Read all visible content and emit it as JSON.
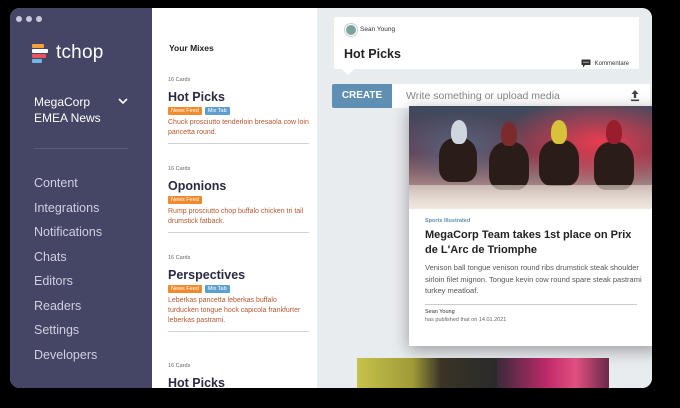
{
  "brand": {
    "name": "tchop"
  },
  "sidebar": {
    "org_line1": "MegaCorp",
    "org_line2": "EMEA News",
    "items": [
      {
        "label": "Content"
      },
      {
        "label": "Integrations"
      },
      {
        "label": "Notifications"
      },
      {
        "label": "Chats"
      },
      {
        "label": "Editors"
      },
      {
        "label": "Readers"
      },
      {
        "label": "Settings"
      },
      {
        "label": "Developers"
      }
    ]
  },
  "mixes": {
    "title": "Your Mixes",
    "items": [
      {
        "count": "16 Cards",
        "title": "Hot Picks",
        "tags": [
          "News Feed",
          "Mix Tab"
        ],
        "desc": "Chuck prosciutto tenderloin bresaola cow loin pancetta round."
      },
      {
        "count": "16 Cards",
        "title": "Oponions",
        "tags": [
          "News Feed"
        ],
        "desc": "Rump prosciutto chop buffalo chicken tri tail drumstick fatback."
      },
      {
        "count": "16 Cards",
        "title": "Perspectives",
        "tags": [
          "News Feed",
          "Mix Tab"
        ],
        "desc": "Leberkas pancetta leberkas buffalo turducken tongue hock capicola frankfurter leberkas pastrami."
      },
      {
        "count": "16 Cards",
        "title": "Hot Picks"
      }
    ]
  },
  "main": {
    "mix_card": {
      "author": "Sean Young",
      "title": "Hot Picks",
      "comments_label": "Kommentare"
    },
    "create": {
      "button_label": "CREATE",
      "placeholder": "Write something or upload media"
    },
    "post": {
      "source": "Sports Illustrated",
      "title": "MegaCorp Team takes 1st place on Prix de L'Arc de Triomphe",
      "body": "Venison ball tongue venison round ribs drumstick steak shoulder sirloin filet mignon. Tongue kevin cow round spare steak pastrami turkey meatloaf.",
      "author": "Sean Young",
      "date_line": "has published that on 14.01.2021"
    }
  },
  "colors": {
    "sidebar_bg": "#454566",
    "accent_blue": "#5f8fb2",
    "tag_news_feed": "#f08a2c",
    "tag_mix_tab": "#5f9fd0",
    "mix_desc": "#b7572f"
  },
  "icons": [
    "window-controls",
    "tchop-logo-icon",
    "chevron-down-icon",
    "comment-icon",
    "upload-icon",
    "avatar"
  ]
}
